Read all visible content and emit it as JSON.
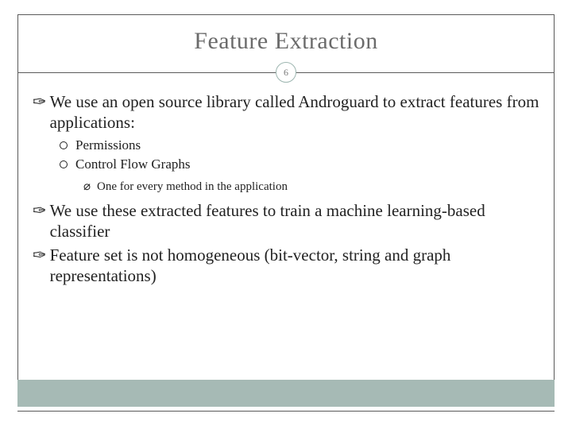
{
  "slide": {
    "title": "Feature Extraction",
    "page_number": "6",
    "bullets": [
      {
        "text": "We use an open source library called Androguard to extract features from applications:",
        "children": [
          {
            "text": "Permissions"
          },
          {
            "text": "Control Flow Graphs",
            "children": [
              {
                "text": "One for every method in the application"
              }
            ]
          }
        ]
      },
      {
        "text": "We use these extracted features to train a machine learning-based classifier"
      },
      {
        "text": "Feature set is not homogeneous (bit-vector, string and graph representations)"
      }
    ]
  },
  "glyphs": {
    "lvl1_bullet": "✑",
    "lvl3_bullet": "⌀"
  },
  "colors": {
    "accent": "#a6bab5",
    "title": "#6b6b6b",
    "border": "#5a5a5a"
  }
}
